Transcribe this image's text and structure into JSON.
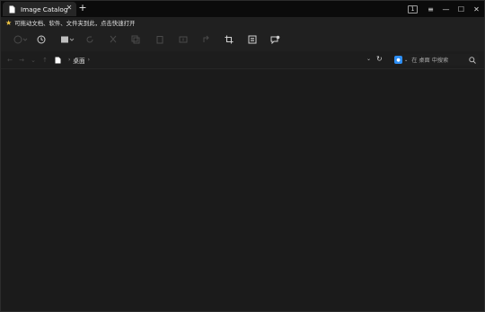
{
  "tab": {
    "title": "Image Catalog",
    "close": "✕",
    "new": "+"
  },
  "window_controls": {
    "badge": "1",
    "menu": "≡",
    "minimize": "—",
    "maximize": "☐",
    "close": "✕"
  },
  "quickbar": {
    "text": "可拖动文档、软件、文件夹到此，点击快速打开"
  },
  "address": {
    "folder": "桌面",
    "separator": "›"
  },
  "search": {
    "placeholder": "在 桌面 中搜索"
  },
  "colors": {
    "accent": "#2d8ef5",
    "star": "#f2c744",
    "background": "#1b1b1b"
  }
}
